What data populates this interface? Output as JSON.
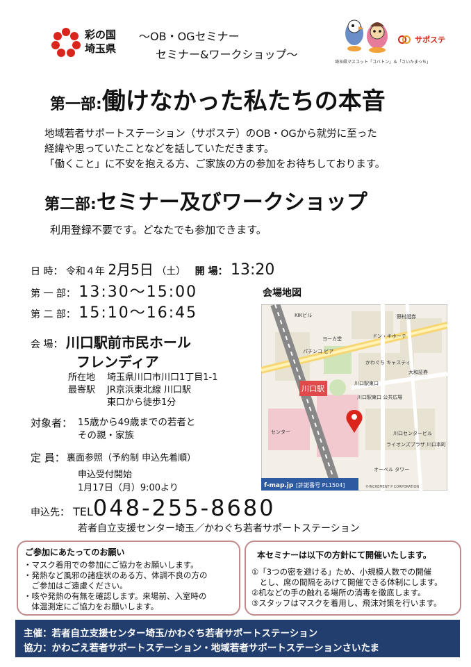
{
  "header": {
    "pref_name_line1": "彩の国",
    "pref_name_line2": "埼玉県",
    "subtitle_line1": "～OB・OGセミナー",
    "subtitle_line2": "セミナー&ワークショップ～",
    "mascot_caption": "埼玉県マスコット「コバトン」＆「さいたまっち」",
    "saposute_logo": "サポステ"
  },
  "part1": {
    "prefix": "第一部:",
    "title": "働けなかった私たちの本音"
  },
  "intro": {
    "line1": "地域若者サポートステーション（サポステ）のOB・OGから就労に至った",
    "line2": "経緯や思っていたことなどを話していただきます。",
    "line3": "「働くこと」に不安を抱える方、ご家族の方の参加をお待ちしております。"
  },
  "part2": {
    "prefix": "第二部:",
    "title": "セミナー及びワークショップ"
  },
  "note_registration": "利用登録不要です。どなたでも参加できます。",
  "schedule": {
    "date_label": "日 時：",
    "era": "令和４年",
    "month": "2月",
    "day": "5日",
    "weekday": "（土）",
    "open_label": "開 場：",
    "open_time": "13:20",
    "part1_label": "第 一 部：",
    "part1_time": "13:30～15:00",
    "part2_label": "第 二 部：",
    "part2_time": "15:10～16:45"
  },
  "map": {
    "label": "会場地図",
    "station_label": "川口駅",
    "credit": "f-map.jp",
    "permit": "[許諾番号 PL1504]",
    "corp": "©INCREMENT P CORPORATION",
    "labels": [
      "KIKビル",
      "野村證券",
      "ドン・キホーテ",
      "かわぐち キャスティ",
      "大和証券",
      "川口駅東口",
      "川口センタービル",
      "ライオンズプラザ 川口本町",
      "オーベル タワー",
      "パチンコ ビア",
      "ヨーカ堂",
      "川口駅東口 公共広場",
      "センター"
    ]
  },
  "venue": {
    "label": "会 場：",
    "name_line1": "川口駅前市民ホール",
    "name_line2": "フレンディア",
    "address_label": "所在地",
    "address": "埼玉県川口市川口1丁目1-1",
    "station_label": "最寄駅",
    "station": "JR京浜東北線 川口駅",
    "walk": "東口から徒歩1分"
  },
  "target": {
    "label": "対象者：",
    "line1": "15歳から49歳までの若者と",
    "line2": "その親・家族"
  },
  "capacity": {
    "label": "定 員：",
    "value": "裏面参照（予約制 申込先着順）"
  },
  "reception": {
    "line1": "申込受付開始",
    "line2": "1月17日（月）9:00より"
  },
  "contact": {
    "label": "申込先：",
    "tel_prefix": "TEL",
    "number": "048-255-8680",
    "org": "若者自立支援センター埼玉／かわぐち若者サポートステーション"
  },
  "notice_left": {
    "title": "ご参加にあたってのお願い",
    "items": [
      "・マスク着用での参加にご協力をお願いします。",
      "・発熱など風邪の諸症状のある方、体調不良の方の",
      "　ご参加はご遠慮ください。",
      "・咳や発熱の有無を確認します。来場前、入室時の",
      "　体温測定にご協力をお願いします。"
    ]
  },
  "notice_right": {
    "title": "本セミナーは以下の方針にて開催いたします。",
    "items": [
      "①「3つの密を避ける」ため、小規模人数での開催",
      "　とし、席の間隔をあけて開催できる体制にします。",
      "②机などの手の触れる場所の消毒を徹底します。",
      "③スタッフはマスクを着用し、飛沫対策を行います。"
    ]
  },
  "footer": {
    "sponsor_label": "主催：",
    "sponsor": "若者自立支援センター埼玉/かわぐち若者サポートステーション",
    "support_label": "協力：",
    "support": "かわごえ若者サポートステーション・地域若者サポートステーションさいたま"
  },
  "colors": {
    "footer_bg": "#213e6f",
    "box_border": "#c08a8a",
    "logo_red": "#d9251c",
    "map_pin": "#d9251c"
  }
}
